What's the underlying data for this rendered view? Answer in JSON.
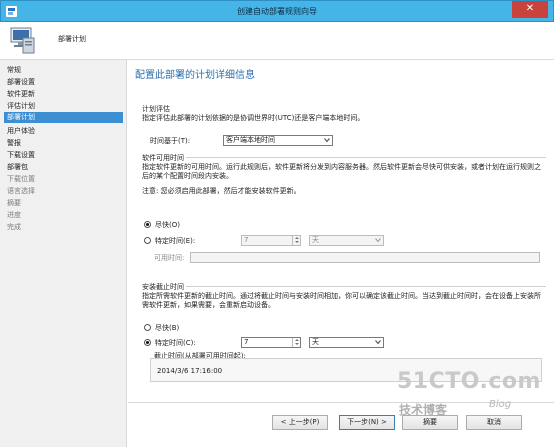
{
  "window": {
    "title": "创建自动部署规则向导",
    "close_label": "✕"
  },
  "header": {
    "label": "部署计划"
  },
  "sidebar": {
    "items": [
      {
        "label": "常规",
        "state": "normal"
      },
      {
        "label": "部署设置",
        "state": "normal"
      },
      {
        "label": "软件更新",
        "state": "normal"
      },
      {
        "label": "评估计划",
        "state": "normal"
      },
      {
        "label": "部署计划",
        "state": "active"
      },
      {
        "label": "用户体验",
        "state": "normal"
      },
      {
        "label": "警报",
        "state": "normal"
      },
      {
        "label": "下载设置",
        "state": "normal"
      },
      {
        "label": "部署包",
        "state": "normal"
      },
      {
        "label": "下载位置",
        "state": "disabled"
      },
      {
        "label": "语言选择",
        "state": "disabled"
      },
      {
        "label": "摘要",
        "state": "disabled"
      },
      {
        "label": "进度",
        "state": "disabled"
      },
      {
        "label": "完成",
        "state": "disabled"
      }
    ]
  },
  "main": {
    "title": "配置此部署的计划详细信息",
    "schedule_eval": {
      "title": "计划评估",
      "description": "指定评估此部署的计划依据的是协调世界时(UTC)还是客户端本地时间。",
      "time_based_label": "时间基于(T):",
      "time_based_value": "客户端本地时间"
    },
    "availability": {
      "title": "软件可用时间",
      "description": "指定软件更新的可用时间。运行此规则后，软件更新将分发到内容服务器。然后软件更新会尽快可供安装，或者计划在运行规则之后的某个配置时间段内安装。",
      "note": "注意:  您必须启用此部署，然后才能安装软件更新。",
      "option_asap": "尽快(O)",
      "option_specific": "特定时间(E):",
      "spin_value": "7",
      "unit_value": "天",
      "avail_time_label": "可用时间:"
    },
    "deadline": {
      "title": "安装截止时间",
      "description": "指定所需软件更新的截止时间。通过将截止时间与安装时间相加，你可以确定该截止时间。当达到截止时间时，会在设备上安装所需软件更新，如果需要，会重新启动设备。",
      "option_asap": "尽快(B)",
      "option_specific": "特定时间(C):",
      "spin_value": "7",
      "unit_value": "天",
      "deadline_label": "截止时间(从部署可用时间起):",
      "deadline_value": "2014/3/6 17:16:00"
    }
  },
  "footer": {
    "prev": "< 上一步(P)",
    "next": "下一步(N) >",
    "summary": "摘要",
    "cancel": "取消"
  },
  "watermark": {
    "big": "51CTO.com",
    "small": "技术博客",
    "blog": "Blog"
  },
  "colors": {
    "titlebar": "#45b5e8",
    "accent": "#2b6fae",
    "active_nav": "#3d8fd3",
    "close": "#c7433b"
  }
}
